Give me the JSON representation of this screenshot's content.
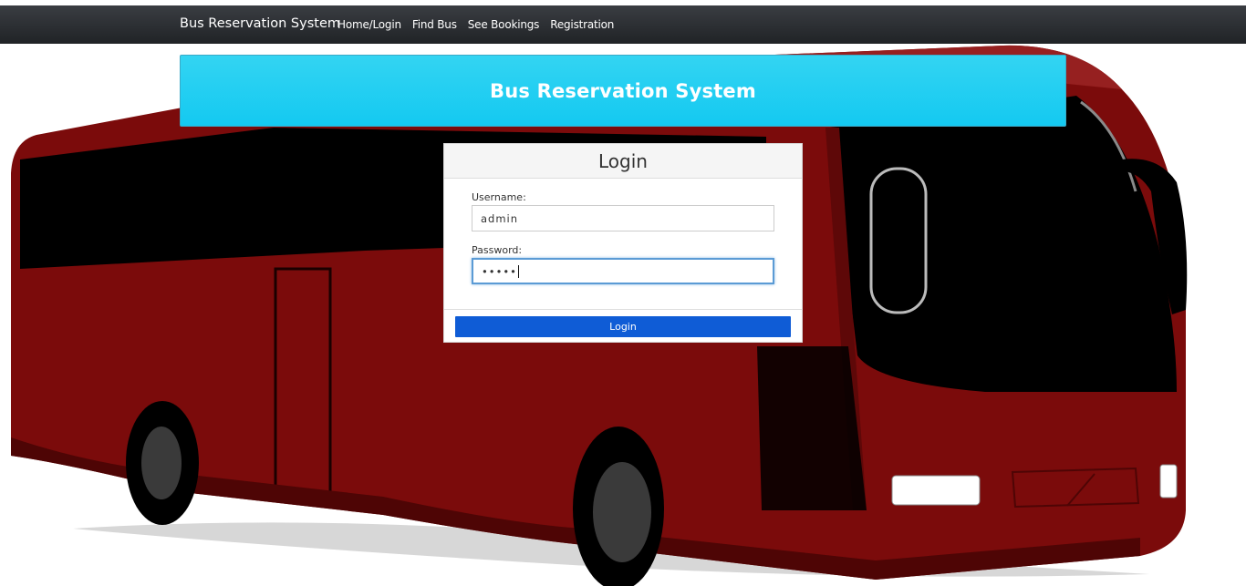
{
  "navbar": {
    "brand": "Bus Reservation System",
    "links": [
      "Home/Login",
      "Find Bus",
      "See Bookings",
      "Registration"
    ]
  },
  "banner": {
    "title": "Bus Reservation System"
  },
  "login": {
    "title": "Login",
    "username_label": "Username:",
    "username_value": "admin",
    "password_label": "Password:",
    "password_mask": "•••••",
    "submit_label": "Login"
  },
  "colors": {
    "navbar": "#2a2d31",
    "banner": "#1fcdf2",
    "login_button": "#0f5cd6",
    "bus_body": "#7a0a0a"
  }
}
